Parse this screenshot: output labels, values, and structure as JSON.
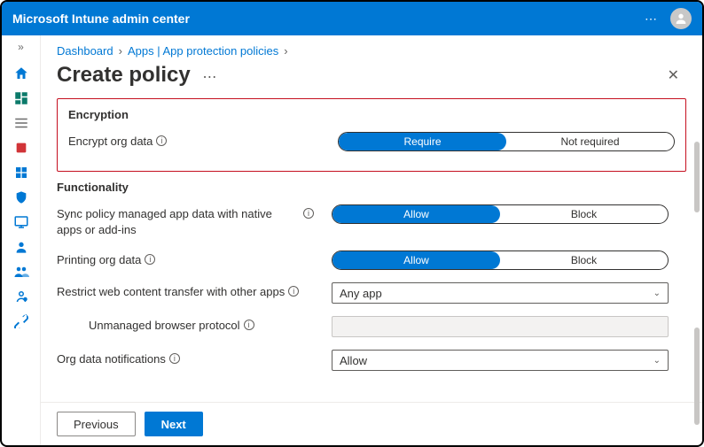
{
  "header": {
    "product": "Microsoft Intune admin center"
  },
  "breadcrumb": {
    "items": [
      "Dashboard",
      "Apps | App protection policies"
    ]
  },
  "page": {
    "title": "Create policy"
  },
  "sections": {
    "encryption": {
      "title": "Encryption",
      "encrypt_org_data": {
        "label": "Encrypt org data",
        "opt1": "Require",
        "opt2": "Not required"
      }
    },
    "functionality": {
      "title": "Functionality",
      "sync_policy": {
        "label": "Sync policy managed app data with native apps or add-ins",
        "opt1": "Allow",
        "opt2": "Block"
      },
      "printing": {
        "label": "Printing org data",
        "opt1": "Allow",
        "opt2": "Block"
      },
      "restrict_web": {
        "label": "Restrict web content transfer with other apps",
        "value": "Any app"
      },
      "unmanaged_browser": {
        "label": "Unmanaged browser protocol",
        "value": ""
      },
      "notifications": {
        "label": "Org data notifications",
        "value": "Allow"
      }
    }
  },
  "footer": {
    "previous": "Previous",
    "next": "Next"
  }
}
